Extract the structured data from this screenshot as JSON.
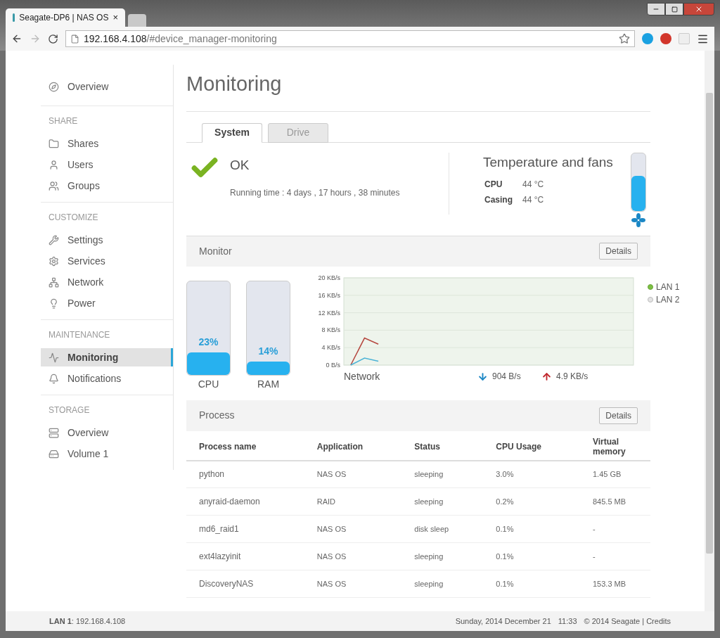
{
  "browser": {
    "tab_title": "Seagate-DP6 | NAS OS",
    "close": "×",
    "url_host": "192.168.4.108",
    "url_path": "/#device_manager-monitoring"
  },
  "sidebar": {
    "sections": [
      {
        "items": [
          {
            "label": "Overview",
            "selected": false
          }
        ]
      },
      {
        "title": "SHARE",
        "items": [
          {
            "label": "Shares",
            "selected": false
          },
          {
            "label": "Users",
            "selected": false
          },
          {
            "label": "Groups",
            "selected": false
          }
        ]
      },
      {
        "title": "CUSTOMIZE",
        "items": [
          {
            "label": "Settings",
            "selected": false
          },
          {
            "label": "Services",
            "selected": false
          },
          {
            "label": "Network",
            "selected": false
          },
          {
            "label": "Power",
            "selected": false
          }
        ]
      },
      {
        "title": "MAINTENANCE",
        "items": [
          {
            "label": "Monitoring",
            "selected": true
          },
          {
            "label": "Notifications",
            "selected": false
          }
        ]
      },
      {
        "title": "STORAGE",
        "items": [
          {
            "label": "Overview",
            "selected": false
          },
          {
            "label": "Volume 1",
            "selected": false
          }
        ]
      }
    ]
  },
  "page_title": "Monitoring",
  "tabs": [
    {
      "label": "System",
      "selected": true
    },
    {
      "label": "Drive",
      "selected": false
    }
  ],
  "status": {
    "label": "OK",
    "running_time": "Running time : 4 days , 17 hours , 38 minutes"
  },
  "temperature": {
    "title": "Temperature and fans",
    "rows": [
      {
        "name": "CPU",
        "value": "44 °C"
      },
      {
        "name": "Casing",
        "value": "44 °C"
      }
    ],
    "level": 0.6
  },
  "monitor": {
    "title": "Monitor",
    "details": "Details",
    "meters": [
      {
        "name": "CPU",
        "reading": "23%",
        "level": 0.23
      },
      {
        "name": "RAM",
        "reading": "14%",
        "level": 0.14
      }
    ],
    "network": {
      "label": "Network",
      "download": "904 B/s",
      "upload": "4.9 KB/s",
      "chart_data": {
        "type": "line",
        "grid": true,
        "categories": [
          null,
          null,
          null,
          null,
          null,
          null,
          null,
          null,
          null,
          null,
          null,
          null,
          null,
          null,
          null,
          null,
          null,
          null,
          null,
          null,
          null
        ],
        "ylim": [
          0,
          20
        ],
        "yticks": [
          {
            "value": 0,
            "label": "0 B/s"
          },
          {
            "value": 4,
            "label": "4 KB/s"
          },
          {
            "value": 8,
            "label": "8 KB/s"
          },
          {
            "value": 12,
            "label": "12 KB/s"
          },
          {
            "value": 16,
            "label": "16 KB/s"
          },
          {
            "value": 20,
            "label": "20 KB/s"
          }
        ],
        "series": [
          {
            "color": "#b5473f",
            "values": [
              0,
              6.2,
              4.8,
              null,
              null,
              null,
              null,
              null,
              null,
              null,
              null,
              null,
              null,
              null,
              null,
              null,
              null,
              null,
              null,
              null,
              null
            ]
          },
          {
            "color": "#4bb3d6",
            "values": [
              0,
              1.6,
              0.9,
              null,
              null,
              null,
              null,
              null,
              null,
              null,
              null,
              null,
              null,
              null,
              null,
              null,
              null,
              null,
              null,
              null,
              null
            ]
          }
        ]
      }
    },
    "legend": [
      {
        "label": "LAN 1",
        "selected": true
      },
      {
        "label": "LAN 2",
        "selected": false
      }
    ]
  },
  "process": {
    "title": "Process",
    "details": "Details",
    "columns": [
      "Process name",
      "Application",
      "Status",
      "CPU Usage",
      "Virtual memory"
    ],
    "rows": [
      [
        "python",
        "NAS OS",
        "sleeping",
        "3.0%",
        "1.45 GB"
      ],
      [
        "anyraid-daemon",
        "RAID",
        "sleeping",
        "0.2%",
        "845.5 MB"
      ],
      [
        "md6_raid1",
        "NAS OS",
        "disk sleep",
        "0.1%",
        "-"
      ],
      [
        "ext4lazyinit",
        "NAS OS",
        "sleeping",
        "0.1%",
        "-"
      ],
      [
        "DiscoveryNAS",
        "NAS OS",
        "sleeping",
        "0.1%",
        "153.3 MB"
      ]
    ]
  },
  "footer": {
    "lan": "**LAN 1**: 192.168.4.108",
    "date": "Sunday, 2014 December 21",
    "time": "11:33",
    "copyright": "© 2014 Seagate | Credits"
  }
}
